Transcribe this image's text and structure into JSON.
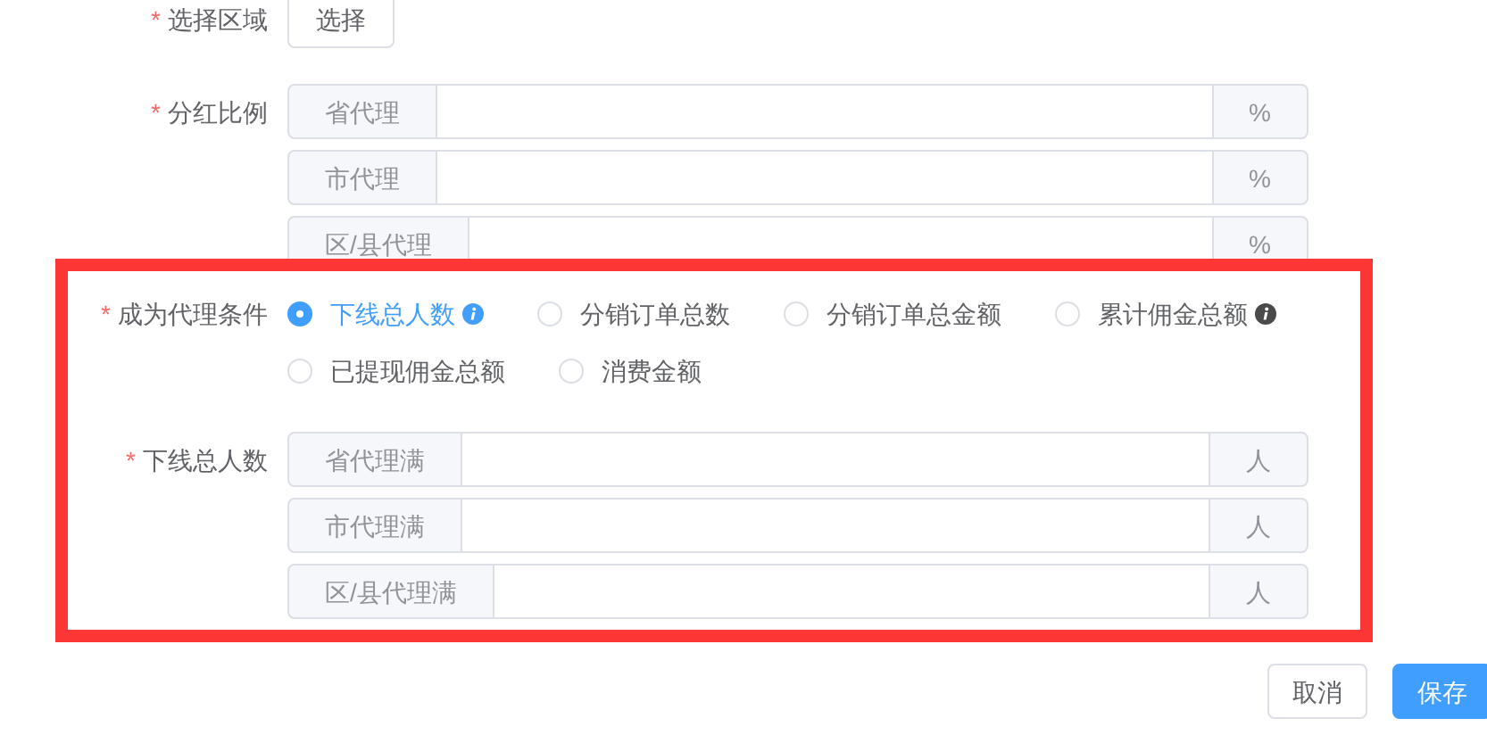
{
  "region": {
    "label": "选择区域",
    "required_mark": "*",
    "button": "选择"
  },
  "ratio": {
    "label": "分红比例",
    "required_mark": "*",
    "inputs": [
      {
        "prefix": "省代理",
        "suffix": "%"
      },
      {
        "prefix": "市代理",
        "suffix": "%"
      },
      {
        "prefix": "区/县代理",
        "suffix": "%"
      }
    ]
  },
  "condition": {
    "label": "成为代理条件",
    "required_mark": "*",
    "options": [
      {
        "label": "下线总人数",
        "selected": true,
        "info": true
      },
      {
        "label": "分销订单总数",
        "selected": false,
        "info": false
      },
      {
        "label": "分销订单总金额",
        "selected": false,
        "info": false
      },
      {
        "label": "累计佣金总额",
        "selected": false,
        "info": true
      },
      {
        "label": "已提现佣金总额",
        "selected": false,
        "info": false
      },
      {
        "label": "消费金额",
        "selected": false,
        "info": false
      }
    ]
  },
  "downline": {
    "label": "下线总人数",
    "required_mark": "*",
    "inputs": [
      {
        "prefix": "省代理满",
        "suffix": "人"
      },
      {
        "prefix": "市代理满",
        "suffix": "人"
      },
      {
        "prefix": "区/县代理满",
        "suffix": "人"
      }
    ]
  },
  "highlight": {
    "kind": "frame"
  },
  "buttons": [
    {
      "label": "取消",
      "kind": "default"
    },
    {
      "label": "保存",
      "kind": "primary"
    }
  ]
}
